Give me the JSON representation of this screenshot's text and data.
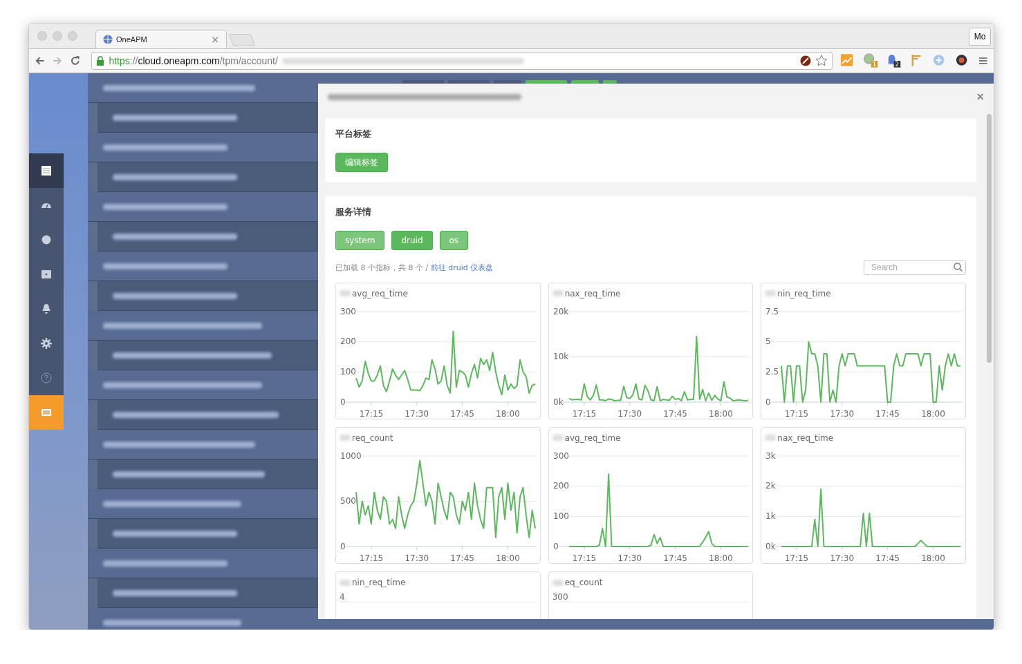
{
  "browser": {
    "tab": {
      "title": "OneAPM",
      "close": "×"
    },
    "profile_button": "Mo",
    "url": {
      "scheme": "https",
      "separator": "://",
      "host": "cloud.oneapm.com",
      "path": "/tpm/account/"
    },
    "extensions": [
      {
        "kind": "chart"
      },
      {
        "kind": "ghost-dot",
        "badge": "1"
      },
      {
        "kind": "ghost",
        "badge": "2"
      },
      {
        "kind": "sign"
      },
      {
        "kind": "command"
      },
      {
        "kind": "gauge"
      }
    ]
  },
  "sidebar": {
    "items": [
      {
        "selected": false
      },
      {
        "selected": false
      },
      {
        "selected": false
      },
      {
        "selected": false
      },
      {
        "selected": false
      },
      {
        "selected": false
      },
      {
        "selected": false
      },
      {
        "selected": true
      }
    ]
  },
  "modal": {
    "close": "×",
    "platform_tags": {
      "title": "平台标签",
      "button": "编辑标签"
    },
    "service": {
      "title": "服务详情",
      "tags": [
        {
          "label": "system",
          "selected": false
        },
        {
          "label": "druid",
          "selected": true
        },
        {
          "label": "os",
          "selected": false
        }
      ],
      "info": "已加载 8 个指标，共 8 个 / ",
      "link": "前往 druid 仪表盘",
      "search": {
        "placeholder": "Search"
      },
      "charts": [
        {
          "title": "avg_req_time",
          "chart_data": {
            "type": "line",
            "ylim": [
              0,
              300
            ],
            "yticks": [
              {
                "value": 0,
                "label": "0"
              },
              {
                "value": 100,
                "label": "100"
              },
              {
                "value": 200,
                "label": "200"
              },
              {
                "value": 300,
                "label": "300"
              }
            ],
            "categories": [
              null,
              null,
              null,
              null,
              null,
              "17:15",
              null,
              null,
              null,
              null,
              null,
              null,
              null,
              null,
              null,
              null,
              null,
              null,
              null,
              null,
              "17:30",
              null,
              null,
              null,
              null,
              null,
              null,
              null,
              null,
              null,
              null,
              null,
              null,
              null,
              null,
              "17:45",
              null,
              null,
              null,
              null,
              null,
              null,
              null,
              null,
              null,
              null,
              null,
              null,
              null,
              null,
              "18:00",
              null,
              null,
              null,
              null,
              null,
              null,
              null,
              null,
              null
            ],
            "series": [
              {
                "color": "#5cb85c",
                "values": [
                  80,
                  50,
                  70,
                  135,
                  95,
                  70,
                  70,
                  90,
                  120,
                  55,
                  35,
                  70,
                  110,
                  90,
                  75,
                  90,
                  105,
                  75,
                  40,
                  40,
                  40,
                  38,
                  55,
                  80,
                  75,
                  140,
                  110,
                  60,
                  70,
                  120,
                  55,
                  30,
                  235,
                  50,
                  105,
                  100,
                  90,
                  50,
                  95,
                  125,
                  80,
                  145,
                  125,
                  140,
                  105,
                  165,
                  100,
                  55,
                  25,
                  90,
                  40,
                  60,
                  45,
                  55,
                  140,
                  100,
                  85,
                  30,
                  55,
                  60
                ]
              }
            ]
          }
        },
        {
          "title": "nax_req_time",
          "chart_data": {
            "type": "line",
            "ylim": [
              0,
              20000
            ],
            "yticks": [
              {
                "value": 0,
                "label": "0k"
              },
              {
                "value": 10000,
                "label": "10k"
              },
              {
                "value": 20000,
                "label": "20k"
              }
            ],
            "categories": [
              null,
              null,
              null,
              null,
              null,
              "17:15",
              null,
              null,
              null,
              null,
              null,
              null,
              null,
              null,
              null,
              null,
              null,
              null,
              null,
              null,
              "17:30",
              null,
              null,
              null,
              null,
              null,
              null,
              null,
              null,
              null,
              null,
              null,
              null,
              null,
              null,
              "17:45",
              null,
              null,
              null,
              null,
              null,
              null,
              null,
              null,
              null,
              null,
              null,
              null,
              null,
              null,
              "18:00",
              null,
              null,
              null,
              null,
              null,
              null,
              null,
              null,
              null
            ],
            "series": [
              {
                "color": "#5cb85c",
                "values": [
                  800,
                  500,
                  600,
                  600,
                  500,
                  4000,
                  1200,
                  500,
                  1500,
                  3800,
                  500,
                  500,
                  300,
                  700,
                  600,
                  300,
                  400,
                  400,
                  3500,
                  1000,
                  800,
                  1600,
                  4000,
                  700,
                  500,
                  3700,
                  2500,
                  500,
                  300,
                  3400,
                  300,
                  600,
                  500,
                  400,
                  1300,
                  600,
                  800,
                  300,
                  2300,
                  500,
                  600,
                  600,
                  14500,
                  600,
                  2800,
                  300,
                  2000,
                  400,
                  1500,
                  700,
                  300,
                  4500,
                  1100,
                  900,
                  300,
                  400,
                  500,
                  400,
                  300,
                  400
                ]
              }
            ]
          }
        },
        {
          "title": "nin_req_time",
          "chart_data": {
            "type": "line",
            "ylim": [
              0,
              7.5
            ],
            "yticks": [
              {
                "value": 0,
                "label": "0"
              },
              {
                "value": 2.5,
                "label": "2.5"
              },
              {
                "value": 5,
                "label": "5"
              },
              {
                "value": 7.5,
                "label": "7.5"
              }
            ],
            "categories": [
              null,
              null,
              null,
              null,
              null,
              "17:15",
              null,
              null,
              null,
              null,
              null,
              null,
              null,
              null,
              null,
              null,
              null,
              null,
              null,
              null,
              "17:30",
              null,
              null,
              null,
              null,
              null,
              null,
              null,
              null,
              null,
              null,
              null,
              null,
              null,
              null,
              "17:45",
              null,
              null,
              null,
              null,
              null,
              null,
              null,
              null,
              null,
              null,
              null,
              null,
              null,
              null,
              "18:00",
              null,
              null,
              null,
              null,
              null,
              null,
              null,
              null,
              null
            ],
            "series": [
              {
                "color": "#5cb85c",
                "values": [
                  3,
                  0,
                  3,
                  3,
                  0,
                  3,
                  3,
                  0,
                  1,
                  5,
                  4,
                  4,
                  3,
                  0,
                  4,
                  4,
                  0,
                  1,
                  0,
                  3,
                  4,
                  3,
                  4,
                  4,
                  4,
                  3,
                  3,
                  3,
                  3,
                  3,
                  3,
                  3,
                  3,
                  3,
                  3,
                  0,
                  0,
                  3,
                  4,
                  3,
                  3,
                  4,
                  4,
                  4,
                  4,
                  4,
                  3,
                  4,
                  4,
                  4,
                  0,
                  0,
                  3,
                  1,
                  3,
                  4,
                  3,
                  4,
                  3,
                  3
                ]
              }
            ]
          }
        },
        {
          "title": "req_count",
          "chart_data": {
            "type": "line",
            "ylim": [
              0,
              1000
            ],
            "yticks": [
              {
                "value": 0,
                "label": "0"
              },
              {
                "value": 500,
                "label": "500"
              },
              {
                "value": 1000,
                "label": "1000"
              }
            ],
            "categories": [
              null,
              null,
              null,
              null,
              null,
              "17:15",
              null,
              null,
              null,
              null,
              null,
              null,
              null,
              null,
              null,
              null,
              null,
              null,
              null,
              null,
              "17:30",
              null,
              null,
              null,
              null,
              null,
              null,
              null,
              null,
              null,
              null,
              null,
              null,
              null,
              null,
              "17:45",
              null,
              null,
              null,
              null,
              null,
              null,
              null,
              null,
              null,
              null,
              null,
              null,
              null,
              null,
              "18:00",
              null,
              null,
              null,
              null,
              null,
              null,
              null,
              null,
              null
            ],
            "series": [
              {
                "color": "#5cb85c",
                "values": [
                  600,
                  250,
                  500,
                  350,
                  450,
                  250,
                  600,
                  400,
                  300,
                  550,
                  500,
                  250,
                  300,
                  200,
                  550,
                  350,
                  200,
                  350,
                  450,
                  500,
                  700,
                  950,
                  700,
                  450,
                  600,
                  500,
                  250,
                  700,
                  550,
                  400,
                  300,
                  600,
                  550,
                  350,
                  250,
                  500,
                  400,
                  600,
                  300,
                  700,
                  450,
                  300,
                  200,
                  650,
                  650,
                  650,
                  100,
                  550,
                  650,
                  300,
                  700,
                  400,
                  600,
                  150,
                  550,
                  650,
                  350,
                  100,
                  400,
                  200
                ]
              }
            ]
          }
        },
        {
          "title": "avg_req_time",
          "chart_data": {
            "type": "line",
            "ylim": [
              0,
              300
            ],
            "yticks": [
              {
                "value": 0,
                "label": "0"
              },
              {
                "value": 100,
                "label": "100"
              },
              {
                "value": 200,
                "label": "200"
              },
              {
                "value": 300,
                "label": "300"
              }
            ],
            "categories": [
              null,
              null,
              null,
              null,
              null,
              "17:15",
              null,
              null,
              null,
              null,
              null,
              null,
              null,
              null,
              null,
              null,
              null,
              null,
              null,
              null,
              "17:30",
              null,
              null,
              null,
              null,
              null,
              null,
              null,
              null,
              null,
              null,
              null,
              null,
              null,
              null,
              "17:45",
              null,
              null,
              null,
              null,
              null,
              null,
              null,
              null,
              null,
              null,
              null,
              null,
              null,
              null,
              "18:00",
              null,
              null,
              null,
              null,
              null,
              null,
              null,
              null,
              null
            ],
            "series": [
              {
                "color": "#5cb85c",
                "values": [
                  0,
                  0,
                  0,
                  0,
                  0,
                  0,
                  0,
                  0,
                  0,
                  0,
                  5,
                  60,
                  0,
                  240,
                  0,
                  0,
                  0,
                  0,
                  0,
                  0,
                  0,
                  0,
                  0,
                  0,
                  0,
                  0,
                  0,
                  5,
                  40,
                  10,
                  30,
                  0,
                  0,
                  0,
                  0,
                  0,
                  0,
                  0,
                  0,
                  0,
                  0,
                  0,
                  0,
                  0,
                  15,
                  30,
                  50,
                  10,
                  0,
                  0,
                  0,
                  0,
                  0,
                  0,
                  0,
                  0,
                  0,
                  0,
                  0,
                  0
                ]
              }
            ]
          }
        },
        {
          "title": "nax_req_time",
          "chart_data": {
            "type": "line",
            "ylim": [
              0,
              3000
            ],
            "yticks": [
              {
                "value": 0,
                "label": "0k"
              },
              {
                "value": 1000,
                "label": "1k"
              },
              {
                "value": 2000,
                "label": "2k"
              },
              {
                "value": 3000,
                "label": "3k"
              }
            ],
            "categories": [
              null,
              null,
              null,
              null,
              null,
              "17:15",
              null,
              null,
              null,
              null,
              null,
              null,
              null,
              null,
              null,
              null,
              null,
              null,
              null,
              null,
              "17:30",
              null,
              null,
              null,
              null,
              null,
              null,
              null,
              null,
              null,
              null,
              null,
              null,
              null,
              null,
              "17:45",
              null,
              null,
              null,
              null,
              null,
              null,
              null,
              null,
              null,
              null,
              null,
              null,
              null,
              null,
              "18:00",
              null,
              null,
              null,
              null,
              null,
              null,
              null,
              null,
              null
            ],
            "series": [
              {
                "color": "#5cb85c",
                "values": [
                  0,
                  0,
                  0,
                  0,
                  0,
                  0,
                  0,
                  0,
                  0,
                  0,
                  0,
                  900,
                  0,
                  1900,
                  0,
                  0,
                  0,
                  0,
                  0,
                  0,
                  0,
                  0,
                  0,
                  0,
                  0,
                  0,
                  0,
                  1100,
                  0,
                  1100,
                  0,
                  0,
                  0,
                  0,
                  0,
                  0,
                  0,
                  0,
                  0,
                  0,
                  0,
                  0,
                  0,
                  0,
                  0,
                  100,
                  200,
                  100,
                  0,
                  0,
                  0,
                  0,
                  0,
                  0,
                  0,
                  0,
                  0,
                  0,
                  0,
                  0
                ]
              }
            ]
          }
        },
        {
          "title": "nin_req_time",
          "top_tick": "4"
        },
        {
          "title": "eq_count",
          "top_tick": "300"
        }
      ]
    }
  }
}
